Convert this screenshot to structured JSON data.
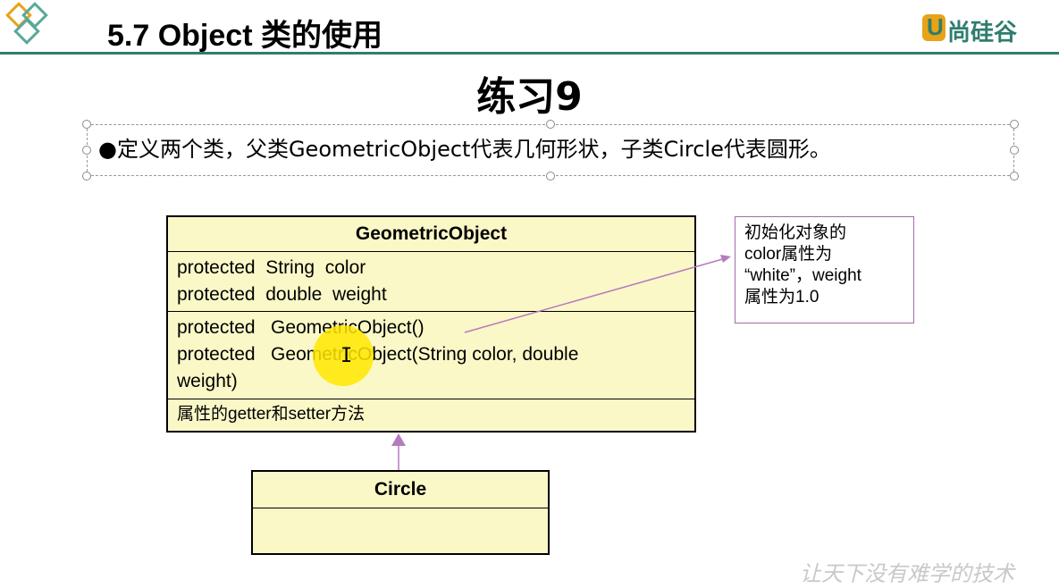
{
  "header": {
    "slide_title": "5.7 Object 类的使用",
    "logo_text": "尚硅谷",
    "logo_mark": "U"
  },
  "exercise_title": "练习9",
  "bullet": {
    "marker": "●",
    "text": "定义两个类，父类GeometricObject代表几何形状，子类Circle代表圆形。"
  },
  "parent_class": {
    "name": "GeometricObject",
    "fields": [
      "protected  String  color",
      "protected  double  weight"
    ],
    "constructors": [
      "protected   GeometricObject()",
      "protected   GeometricObject(String color, double",
      "weight)"
    ],
    "methods": [
      "属性的getter和setter方法"
    ]
  },
  "child_class": {
    "name": "Circle"
  },
  "note": {
    "lines": [
      "初始化对象的",
      "color属性为",
      "“white”，weight",
      "属性为1.0"
    ]
  },
  "watermark": "让天下没有难学的技术",
  "colors": {
    "accent": "#2f7d6e",
    "uml_fill": "#fbf8c8",
    "arrow": "#b57bbf",
    "highlight": "#ffe800"
  },
  "icons": {
    "logo_diamonds": "diamonds-logo-icon",
    "cursor": "text-cursor-icon"
  }
}
